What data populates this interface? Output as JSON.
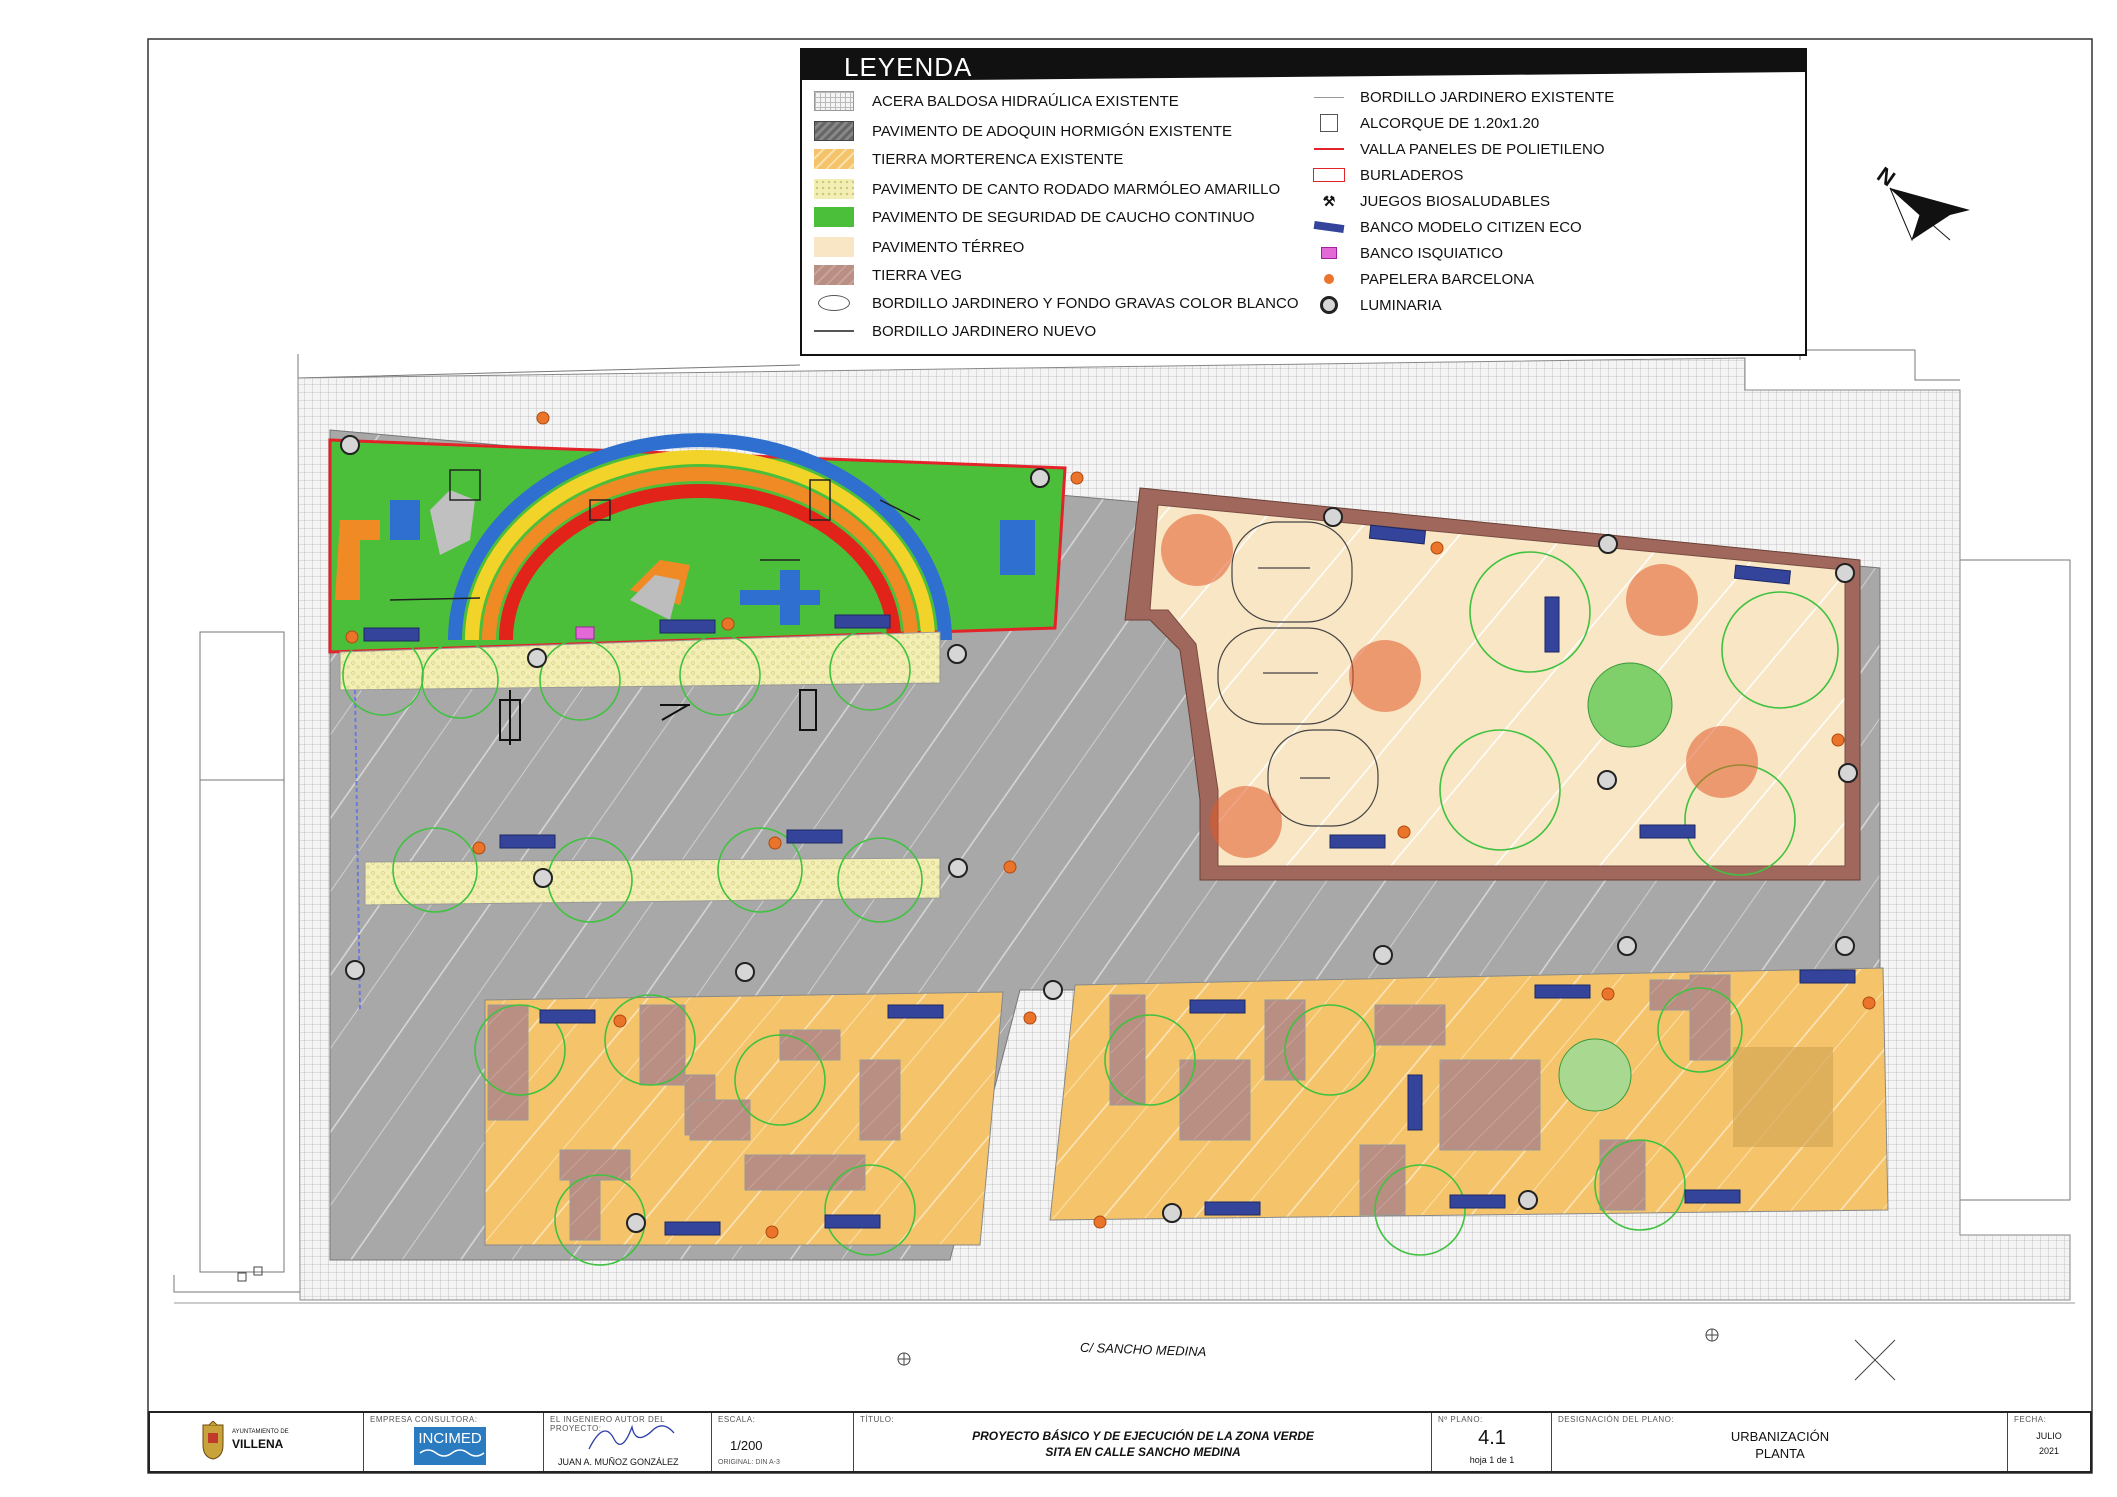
{
  "legend": {
    "title": "LEYENDA",
    "left_items": [
      {
        "label": "ACERA BALDOSA HIDRAÚLICA EXISTENTE",
        "swatch": "tile-grid"
      },
      {
        "label": "PAVIMENTO DE ADOQUIN HORMIGÓN EXISTENTE",
        "swatch": "concrete-paver"
      },
      {
        "label": "TIERRA MORTERENCA EXISTENTE",
        "swatch": "orange-earth"
      },
      {
        "label": "PAVIMENTO DE CANTO RODADO MARMÓLEO AMARILLO",
        "swatch": "yellow-gravel"
      },
      {
        "label": "PAVIMENTO DE SEGURIDAD DE CAUCHO CONTINUO",
        "swatch": "green-rubber"
      },
      {
        "label": "PAVIMENTO TÉRREO",
        "swatch": "beige-earth"
      },
      {
        "label": "TIERRA VEG",
        "swatch": "brown-soil"
      },
      {
        "label": "BORDILLO JARDINERO Y FONDO GRAVAS COLOR BLANCO",
        "swatch": "white-gravel-oval"
      },
      {
        "label": "BORDILLO JARDINERO NUEVO",
        "swatch": "new-curb-line"
      }
    ],
    "right_items": [
      {
        "label": "BORDILLO JARDINERO EXISTENTE",
        "swatch": "existing-curb-line"
      },
      {
        "label": "ALCORQUE DE 1.20x1.20",
        "swatch": "tree-pit-square"
      },
      {
        "label": "VALLA PANELES DE POLIETILENO",
        "swatch": "red-fence-line"
      },
      {
        "label": "BURLADEROS",
        "swatch": "red-outline-box"
      },
      {
        "label": "JUEGOS BIOSALUDABLES",
        "swatch": "fitness-equipment-icon"
      },
      {
        "label": "BANCO MODELO CITIZEN ECO",
        "swatch": "blue-bench"
      },
      {
        "label": "BANCO ISQUIATICO",
        "swatch": "pink-bench"
      },
      {
        "label": "PAPELERA BARCELONA",
        "swatch": "orange-dot"
      },
      {
        "label": "LUMINARIA",
        "swatch": "luminaire-circle"
      }
    ]
  },
  "map": {
    "north_label": "N",
    "street_label": "C/ SANCHO MEDINA",
    "colors": {
      "tile": "#f2f2f2",
      "tile_grid": "#bdbdbd",
      "concrete": "#a9a9a9",
      "orange_earth": "#f5c46a",
      "yellow_gravel": "#f3efb4",
      "green_rubber": "#4cbf3a",
      "beige_earth": "#f8e6c4",
      "brown_soil": "#b98e83",
      "planter_border": "#a0675c",
      "tree_outline": "#3fc23f",
      "bench": "#33449a",
      "bin": "#e9742a",
      "fence": "#e3232a",
      "rainbow": [
        "#2f6fd0",
        "#f2d32a",
        "#f08a24",
        "#e2231a"
      ],
      "isquiatic_bench": "#e36ad6"
    }
  },
  "title_block": {
    "logo_caption_top": "AYUNTAMIENTO DE",
    "logo_caption": "VILLENA",
    "consultant_label": "EMPRESA CONSULTORA:",
    "consultant_logo": "INCIMED",
    "engineer_label": "EL INGENIERO AUTOR DEL PROYECTO:",
    "engineer_name": "JUAN A. MUÑOZ GONZÁLEZ",
    "scale_label": "ESCALA:",
    "scale": "1/200",
    "original": "ORIGINAL: DIN A-3",
    "title_label": "TÍTULO:",
    "title_line1": "PROYECTO BÁSICO Y DE EJECUCIÓN DE LA ZONA VERDE",
    "title_line2": "SITA EN CALLE SANCHO MEDINA",
    "plan_no_label": "Nº PLANO:",
    "plan_no": "4.1",
    "sheet": "hoja 1 de 1",
    "designation_label": "DESIGNACIÓN DEL PLANO:",
    "designation_line1": "URBANIZACIÓN",
    "designation_line2": "PLANTA",
    "date_label": "FECHA:",
    "date_line1": "JULIO",
    "date_line2": "2021"
  }
}
